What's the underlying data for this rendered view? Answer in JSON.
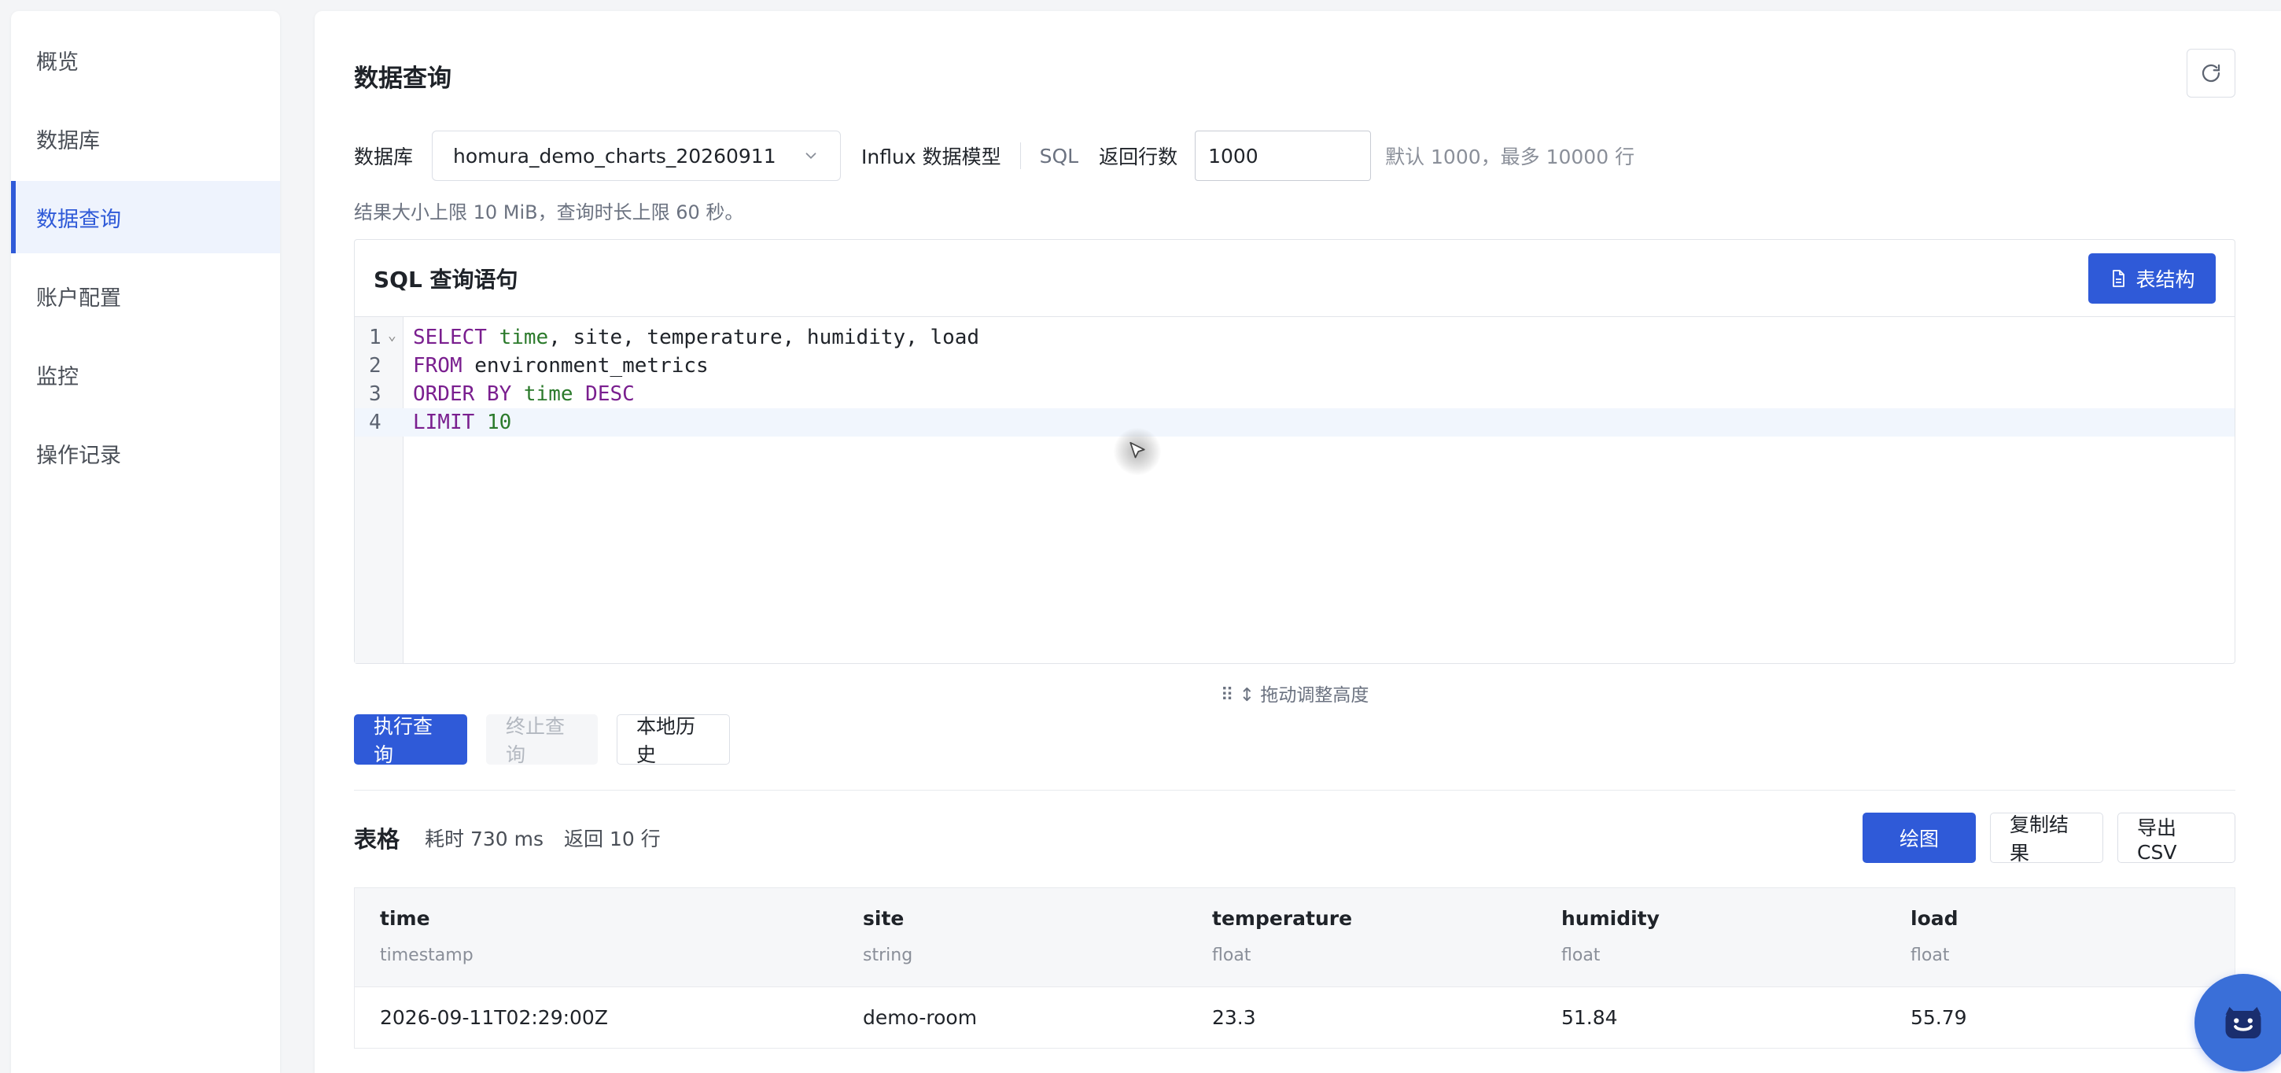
{
  "sidebar": {
    "items": [
      {
        "label": "概览",
        "active": false
      },
      {
        "label": "数据库",
        "active": false
      },
      {
        "label": "数据查询",
        "active": true
      },
      {
        "label": "账户配置",
        "active": false
      },
      {
        "label": "监控",
        "active": false
      },
      {
        "label": "操作记录",
        "active": false
      }
    ]
  },
  "page": {
    "title": "数据查询"
  },
  "query_form": {
    "db_label": "数据库",
    "db_value": "homura_demo_charts_20260911",
    "model_label": "Influx 数据模型",
    "sql_label": "SQL",
    "rows_label": "返回行数",
    "rows_value": "1000",
    "rows_hint": "默认 1000，最多 10000 行",
    "limit_note": "结果大小上限 10 MiB，查询时长上限 60 秒。"
  },
  "editor": {
    "title": "SQL 查询语句",
    "schema_button": "表结构",
    "line_numbers": [
      "1",
      "2",
      "3",
      "4"
    ],
    "drag_hint": "拖动调整高度"
  },
  "actions": {
    "run": "执行查询",
    "stop": "终止查询",
    "history": "本地历史"
  },
  "result": {
    "title": "表格",
    "elapsed": "耗时 730 ms",
    "rows": "返回 10 行",
    "plot_button": "绘图",
    "copy_button": "复制结果",
    "export_button": "导出 CSV"
  },
  "table": {
    "columns": [
      {
        "name": "time",
        "type": "timestamp"
      },
      {
        "name": "site",
        "type": "string"
      },
      {
        "name": "temperature",
        "type": "float"
      },
      {
        "name": "humidity",
        "type": "float"
      },
      {
        "name": "load",
        "type": "float"
      }
    ],
    "rows": [
      [
        "2026-09-11T02:29:00Z",
        "demo-room",
        "23.3",
        "51.84",
        "55.79"
      ]
    ]
  },
  "colors": {
    "accent": "#2f5ad8",
    "keyword": "#7a1f8f",
    "function": "#2b7a2b"
  }
}
